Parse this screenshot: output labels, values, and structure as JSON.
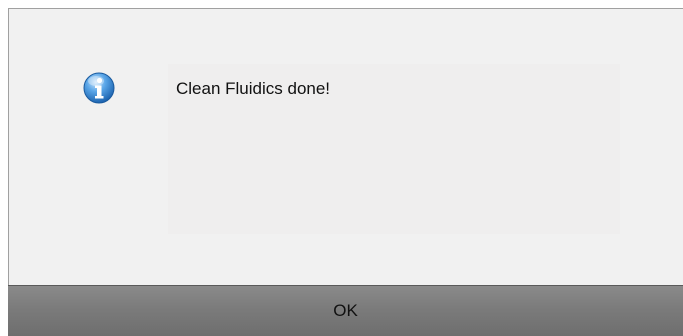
{
  "dialog": {
    "icon": "info-icon",
    "message": "Clean Fluidics done!",
    "ok_label": "OK"
  },
  "colors": {
    "dialog_background": "#f1f1f1",
    "button_background": "#7b7b7b",
    "icon_blue": "#3a8ad6"
  }
}
